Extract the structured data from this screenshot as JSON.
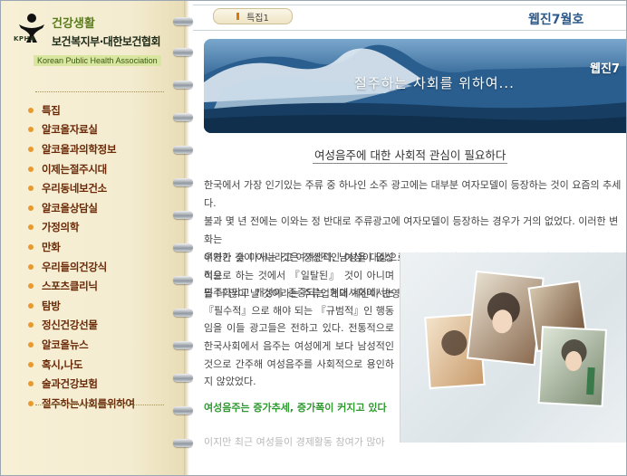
{
  "logo": {
    "kpha": "KPHA",
    "title1": "건강생활",
    "title2": "보건복지부·대한보건협회",
    "english": "Korean Public Health Association"
  },
  "menu": [
    "특집",
    "알코올자료실",
    "알코올과의학정보",
    "이제는절주시대",
    "우리동네보건소",
    "알코올상담실",
    "가정의학",
    "만화",
    "우리들의건강식",
    "스포츠클리닉",
    "탐방",
    "정신건강선물",
    "알코올뉴스",
    "혹시,나도",
    "술과건강보험",
    "절주하는사회를위하여"
  ],
  "header": {
    "tab_label": "특집1",
    "webzine": "웹진7월호"
  },
  "banner": {
    "text": "절주하는 사회를 위하여...",
    "corner_text": "웹진7"
  },
  "article": {
    "title": "여성음주에 대한 사회적 관심이 필요하다",
    "para1": "한국에서 가장 인기있는 주류 중 하나인 소주 광고에는 대부분 여자모델이 등장하는 것이 요즘의 추세다.\n불과 몇 년 전에는 이와는 정 반대로 주류광고에 여자모델이 등장하는 경우가 거의 없었다. 이러한 변화는\n우연한 것이 아니라고 여겨진다. 남성을 대상으로 하는 것보다는 여성을 대상으로 하는 주류마케팅이 이윤\n을 더 많이 낼 것이라는 주류업계의 계산이 반영된 것으로 볼 수 있다.",
    "para2": "여자가 술 마시는 것은 정상적인 여성이 일상적으로 하는 것에서 『일탈된』 것이 아니며 민주화되고 개성이 존중되는 현대사회에서는 『필수적』으로 해야 되는 『규범적』인 행동임을 이들 광고들은 전하고 있다. 전통적으로 한국사회에서 음주는 여성에게 보다 남성적인 것으로 간주해 여성음주를 사회적으로 용인하지 않았었다.",
    "green_heading": "여성음주는 증가추세, 증가폭이 커지고 있다",
    "faded": "이지만 최근 여성들이 경제활동 참여가 많아"
  },
  "colors": {
    "menu_text": "#6a2a08",
    "bullet": "#e89a30",
    "green_heading": "#2e9a2e",
    "webzine": "#2e5a8a"
  }
}
